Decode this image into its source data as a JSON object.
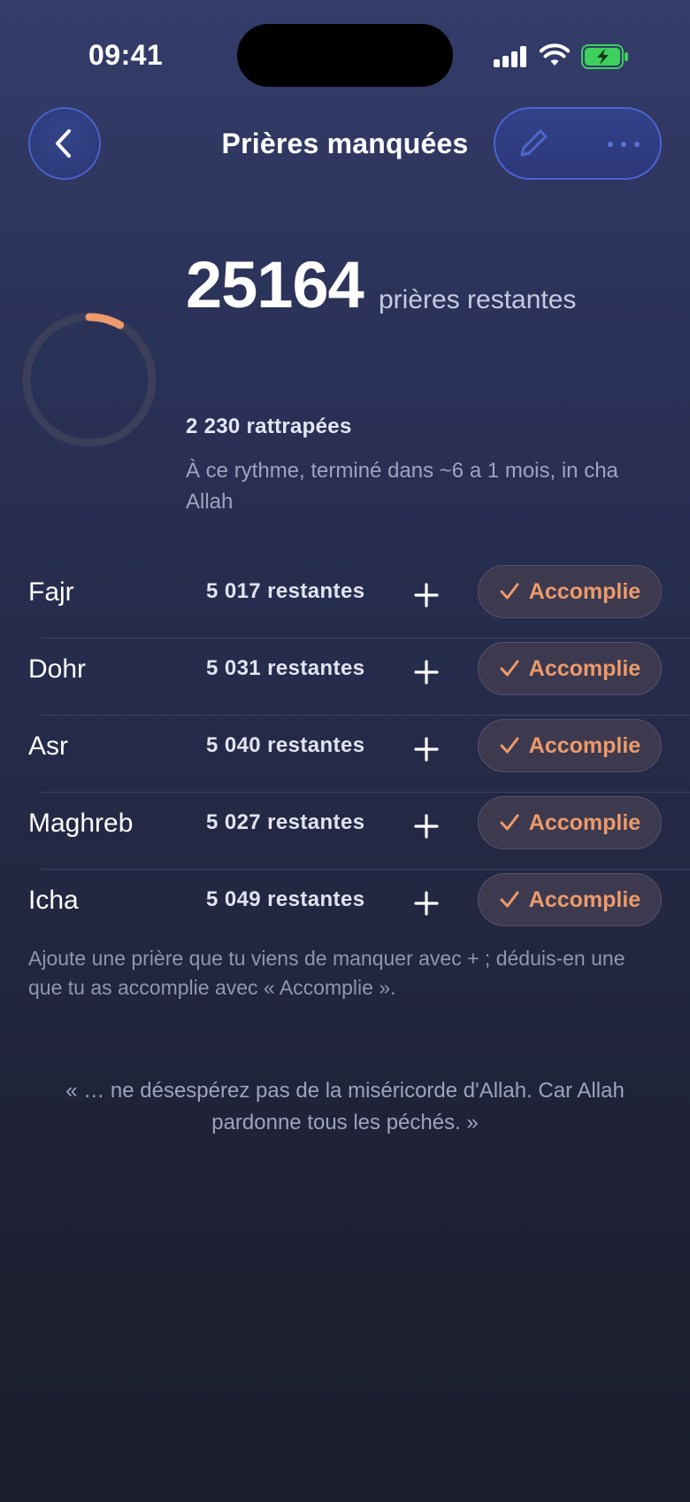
{
  "status_bar": {
    "time": "09:41"
  },
  "header": {
    "title": "Prières manquées"
  },
  "summary": {
    "remaining": "25164",
    "remaining_label": "prières restantes",
    "caught_up": "2 230 rattrapées",
    "pace": "À ce rythme, terminé dans ~6 a 1 mois, in cha Allah",
    "progress_fraction": 0.081
  },
  "prayers": [
    {
      "name": "Fajr",
      "remaining": "5 017 restantes",
      "done_label": "Accomplie"
    },
    {
      "name": "Dohr",
      "remaining": "5 031 restantes",
      "done_label": "Accomplie"
    },
    {
      "name": "Asr",
      "remaining": "5 040 restantes",
      "done_label": "Accomplie"
    },
    {
      "name": "Maghreb",
      "remaining": "5 027 restantes",
      "done_label": "Accomplie"
    },
    {
      "name": "Icha",
      "remaining": "5 049 restantes",
      "done_label": "Accomplie"
    }
  ],
  "hint": "Ajoute une prière que tu viens de manquer avec + ; déduis-en une que tu as accomplie avec « Accomplie ».",
  "quote": "« … ne désespérez pas de la miséricorde d'Allah. Car Allah pardonne tous les péchés. »",
  "colors": {
    "accent": "#ec9a6b",
    "ring_track": "#3b3f5a",
    "header_button": "#4861c9"
  },
  "icons": [
    "chevron-left-icon",
    "pencil-icon",
    "more-icon",
    "plus-icon",
    "check-icon",
    "signal-icon",
    "wifi-icon",
    "battery-icon"
  ]
}
